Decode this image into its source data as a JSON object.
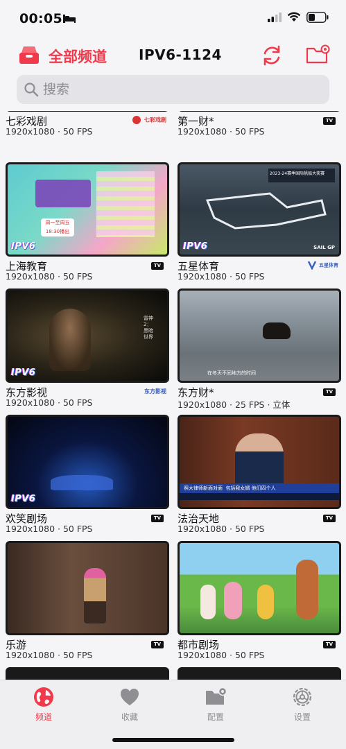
{
  "status": {
    "time": "00:05"
  },
  "header": {
    "all_channels": "全部频道",
    "title": "IPV6-1124"
  },
  "search": {
    "placeholder": "搜索"
  },
  "watermark": "IPV6",
  "top_row": [
    {
      "name": "七彩戏剧",
      "meta": "1920x1080 · 50 FPS",
      "badge": "logo",
      "logo_text": "七彩戏剧"
    },
    {
      "name": "第一财*",
      "meta": "1920x1080 · 50 FPS",
      "badge": "tv",
      "tv_text": "TV"
    }
  ],
  "channels": [
    {
      "name": "上海教育",
      "meta": "1920x1080 · 50 FPS",
      "badge": "tv",
      "tv_text": "TV"
    },
    {
      "name": "五星体育",
      "meta": "1920x1080 · 50 FPS",
      "badge": "logo",
      "logo_text": "五星体育"
    },
    {
      "name": "东方影视",
      "meta": "1920x1080 · 50 FPS",
      "badge": "logo",
      "logo_text": "东方影视"
    },
    {
      "name": "东方财*",
      "meta": "1920x1080 · 25 FPS · 立体",
      "badge": "tv",
      "tv_text": "TV"
    },
    {
      "name": "欢笑剧场",
      "meta": "1920x1080 · 50 FPS",
      "badge": "tv",
      "tv_text": "TV"
    },
    {
      "name": "法治天地",
      "meta": "1920x1080 · 50 FPS",
      "badge": "tv",
      "tv_text": "TV"
    },
    {
      "name": "乐游",
      "meta": "1920x1080 · 50 FPS",
      "badge": "tv",
      "tv_text": "TV"
    },
    {
      "name": "都市剧场",
      "meta": "1920x1080 · 50 FPS",
      "badge": "tv",
      "tv_text": "TV"
    }
  ],
  "thumb_text": {
    "sports_title": "2023-24赛季国际帆船大奖赛",
    "sports_sub": "SAIL GP",
    "movie_caption": "雷神2：黑暗世界",
    "news_caption": "包括我女婿 他们四个人",
    "news_banner": "照大律师新面对面",
    "yak_caption": "在冬天不同地方的时间",
    "edu_schedule": "周一至周五 18:30播出"
  },
  "tabs": [
    {
      "label": "频道",
      "icon": "globe-icon",
      "active": true
    },
    {
      "label": "收藏",
      "icon": "heart-icon",
      "active": false
    },
    {
      "label": "配置",
      "icon": "folder-gear-icon",
      "active": false
    },
    {
      "label": "设置",
      "icon": "gear-icon",
      "active": false
    }
  ],
  "colors": {
    "accent": "#f03a4c",
    "inactive": "#8e8e93"
  }
}
